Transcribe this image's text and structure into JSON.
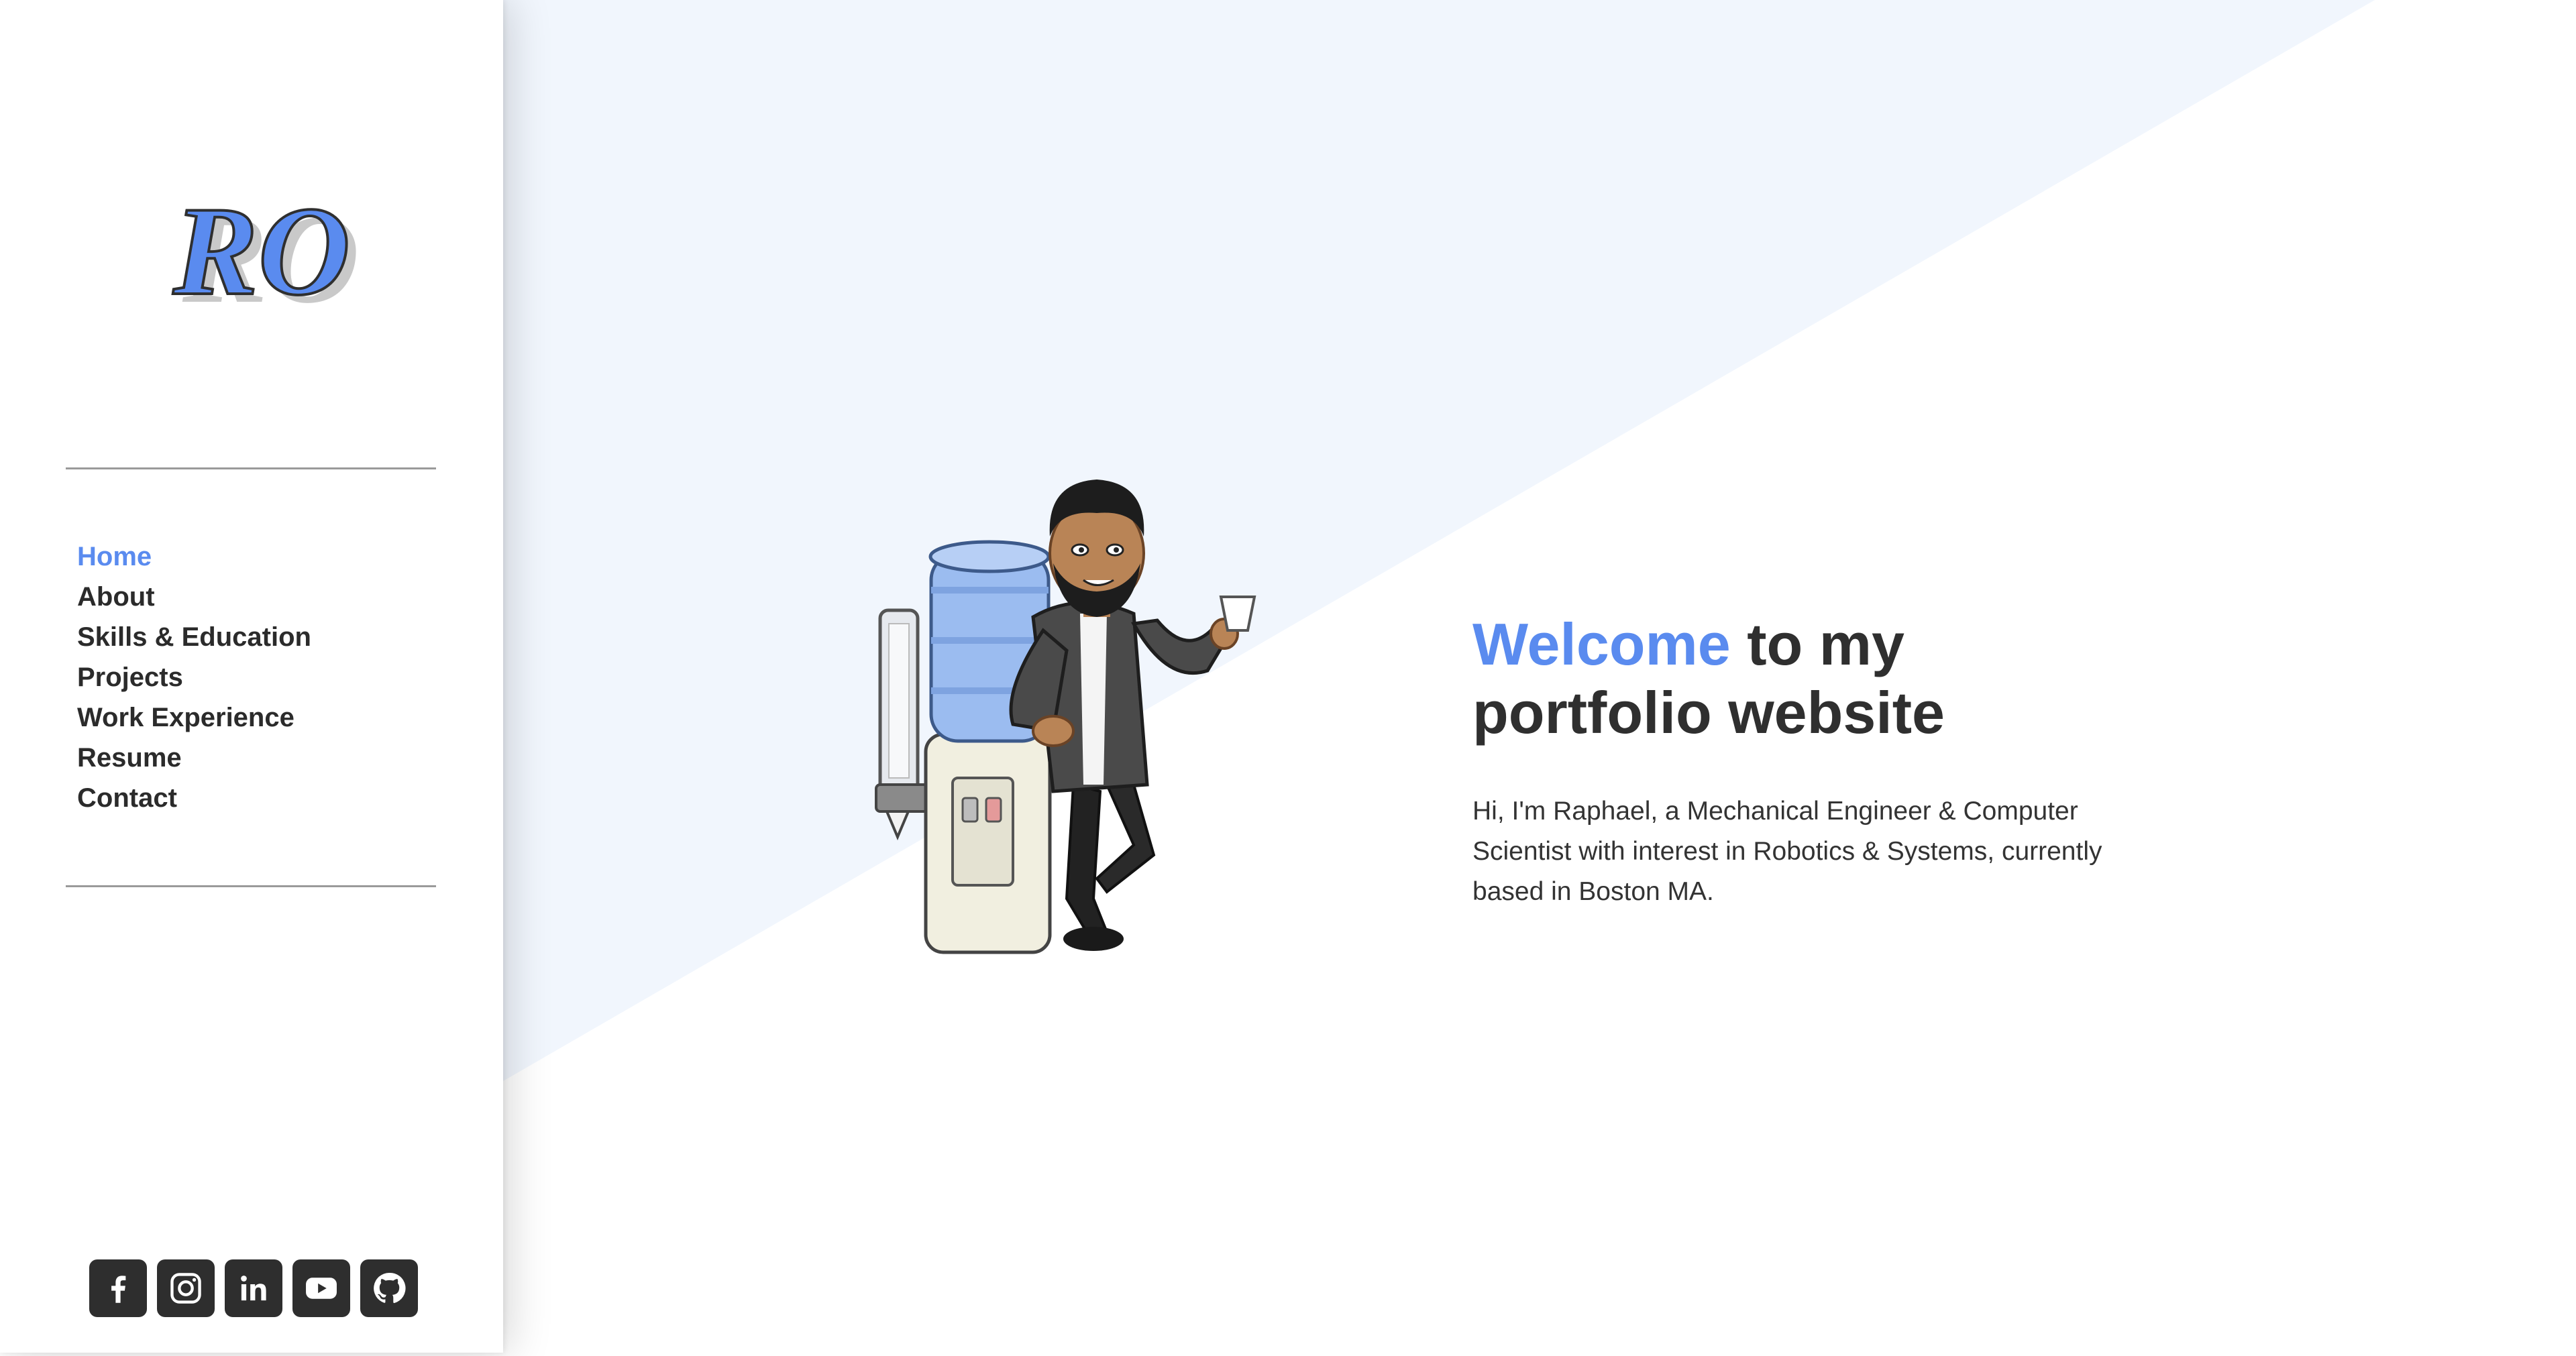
{
  "logo": {
    "text": "RO",
    "color": "#5a8bef"
  },
  "nav": {
    "items": [
      {
        "label": "Home",
        "active": true
      },
      {
        "label": "About"
      },
      {
        "label": "Skills & Education"
      },
      {
        "label": "Projects"
      },
      {
        "label": "Work Experience"
      },
      {
        "label": "Resume"
      },
      {
        "label": "Contact"
      }
    ]
  },
  "socials": [
    {
      "icon": "facebook-icon"
    },
    {
      "icon": "instagram-icon"
    },
    {
      "icon": "linkedin-icon"
    },
    {
      "icon": "youtube-icon"
    },
    {
      "icon": "github-icon"
    }
  ],
  "hero": {
    "title_accent": "Welcome",
    "title_rest": " to my portfolio website",
    "intro": "Hi, I'm Raphael, a Mechanical Engineer & Computer Scientist with interest in Robotics & Systems, currently based in Boston MA.",
    "avatar": "bitmoji-water-cooler-avatar"
  },
  "colors": {
    "accent": "#5a8bef",
    "text": "#2f2f2f",
    "background_tint": "#f1f6fd",
    "icon_bg": "#2e2e2e"
  }
}
